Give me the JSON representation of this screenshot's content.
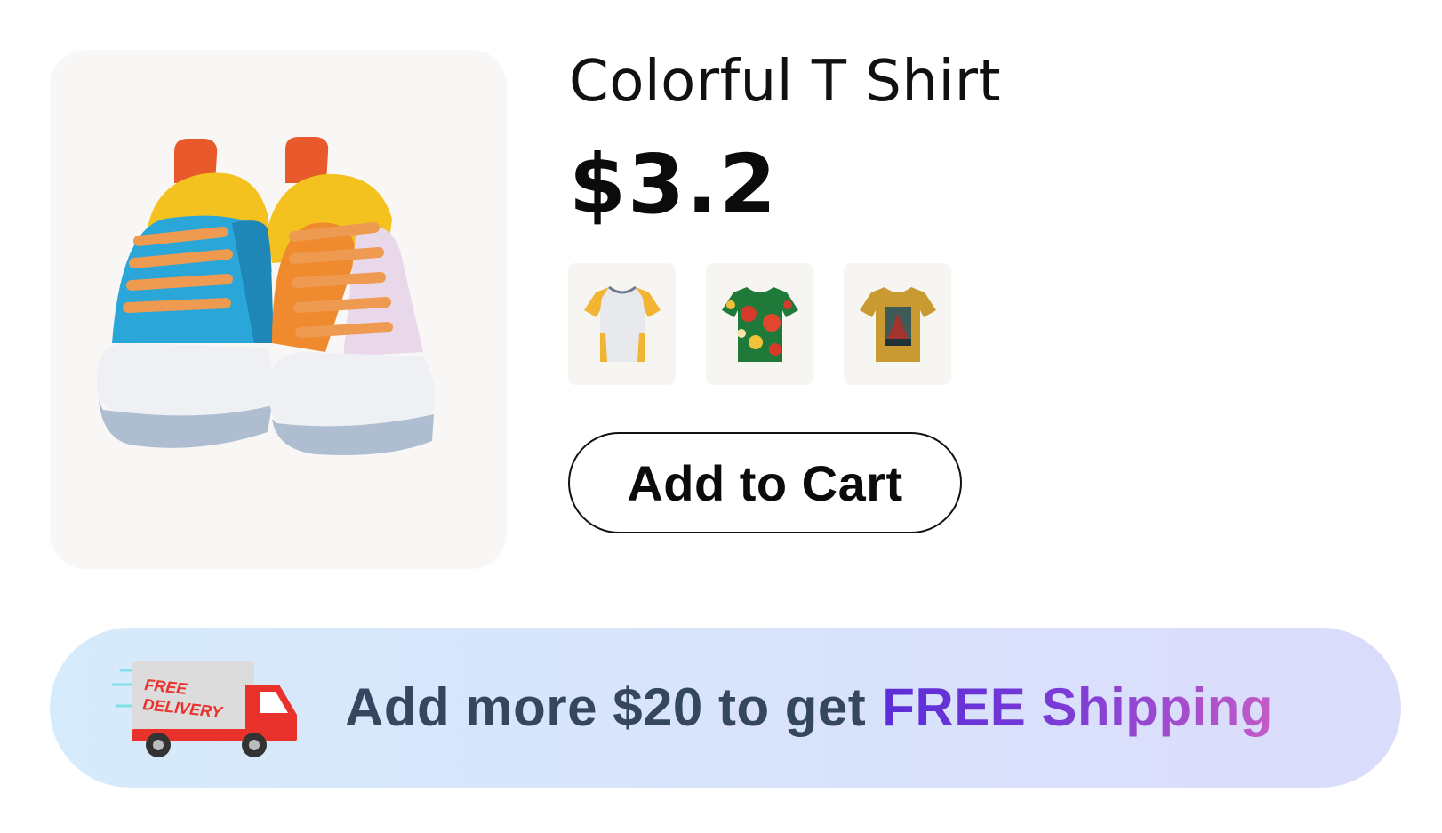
{
  "product": {
    "title": "Colorful T Shirt",
    "price": "$3.2",
    "main_image": "sneakers-image",
    "variants": [
      {
        "name": "raglan-tshirt-thumbnail"
      },
      {
        "name": "floral-tshirt-thumbnail"
      },
      {
        "name": "mustard-tshirt-thumbnail"
      }
    ],
    "add_to_cart_label": "Add to Cart"
  },
  "banner": {
    "prefix": "Add more $20 to get",
    "highlight": "FREE Shipping",
    "truck_text_line1": "FREE",
    "truck_text_line2": "DELIVERY"
  },
  "colors": {
    "title": "#111111",
    "banner_text": "#34475f",
    "highlight_start": "#5b2dd8",
    "highlight_end": "#c25cc7"
  }
}
